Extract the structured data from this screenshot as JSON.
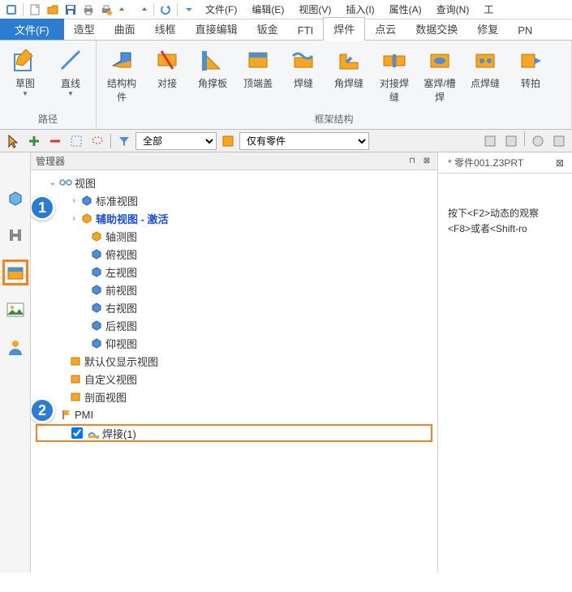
{
  "quickAccess": {
    "items": [
      "app",
      "new",
      "open",
      "save",
      "print",
      "print-preview",
      "undo",
      "redo",
      "sep",
      "refresh",
      "sep",
      "down"
    ]
  },
  "menuBar": {
    "items": [
      "文件(F)",
      "编辑(E)",
      "视图(V)",
      "插入(I)",
      "属性(A)",
      "查询(N)",
      "工"
    ]
  },
  "ribbon": {
    "file": "文件(F)",
    "tabs": [
      "造型",
      "曲面",
      "线框",
      "直接编辑",
      "钣金",
      "FTI",
      "焊件",
      "点云",
      "数据交换",
      "修复",
      "PN"
    ],
    "activeTab": "焊件",
    "group1": {
      "label": "路径",
      "btns": [
        {
          "name": "sketch",
          "label": "草图",
          "dd": true
        },
        {
          "name": "line",
          "label": "直线",
          "dd": true
        }
      ]
    },
    "group2": {
      "label": "框架结构",
      "btns": [
        {
          "name": "struct-member",
          "label": "结构构件",
          "dd": false
        },
        {
          "name": "butt",
          "label": "对接",
          "dd": false
        },
        {
          "name": "gusset",
          "label": "角撑板",
          "dd": false
        },
        {
          "name": "endcap",
          "label": "顶端盖",
          "dd": false
        },
        {
          "name": "weld-bead",
          "label": "焊缝",
          "dd": false
        },
        {
          "name": "fillet-weld",
          "label": "角焊缝",
          "dd": false
        },
        {
          "name": "butt-weld",
          "label": "对接焊缝",
          "dd": false
        },
        {
          "name": "plug-slot",
          "label": "塞焊/槽焊",
          "dd": false
        },
        {
          "name": "spot-weld",
          "label": "点焊缝",
          "dd": false
        },
        {
          "name": "convert",
          "label": "转拍",
          "dd": false
        }
      ]
    }
  },
  "secToolbar": {
    "filter1": "全部",
    "filter2": "仅有零件"
  },
  "manager": {
    "title": "管理器",
    "rootView": "视图",
    "tree": [
      {
        "depth": 1,
        "toggle": "v",
        "icon": "glasses",
        "label": "视图"
      },
      {
        "depth": 2,
        "toggle": ">",
        "icon": "cube-blue",
        "label": "标准视图"
      },
      {
        "depth": 2,
        "toggle": ">",
        "icon": "cube-orange",
        "label": "辅助视图 - 激活",
        "blue": true
      },
      {
        "depth": 3,
        "icon": "cube-orange",
        "label": "轴测图"
      },
      {
        "depth": 3,
        "icon": "cube-blue",
        "label": "俯视图"
      },
      {
        "depth": 3,
        "icon": "cube-blue",
        "label": "左视图"
      },
      {
        "depth": 3,
        "icon": "cube-blue",
        "label": "前视图"
      },
      {
        "depth": 3,
        "icon": "cube-blue",
        "label": "右视图"
      },
      {
        "depth": 3,
        "icon": "cube-blue",
        "label": "后视图"
      },
      {
        "depth": 3,
        "icon": "cube-blue",
        "label": "仰视图"
      },
      {
        "depth": 2,
        "icon": "box-yellow",
        "label": "默认仅显示视图"
      },
      {
        "depth": 2,
        "icon": "box-yellow",
        "label": "自定义视图"
      },
      {
        "depth": 2,
        "icon": "box-yellow",
        "label": "剖面视图"
      },
      {
        "depth": 1,
        "toggle": "v",
        "icon": "flag",
        "label": "PMI"
      },
      {
        "depth": 2,
        "check": true,
        "icon": "weld",
        "label": "焊接(1)",
        "highlight": true
      }
    ]
  },
  "rightPane": {
    "tab": "零件001.Z3PRT",
    "hint1": "按下<F2>动态的观察",
    "hint2": "<F8>或者<Shift-ro"
  },
  "callouts": {
    "one": "1",
    "two": "2"
  }
}
